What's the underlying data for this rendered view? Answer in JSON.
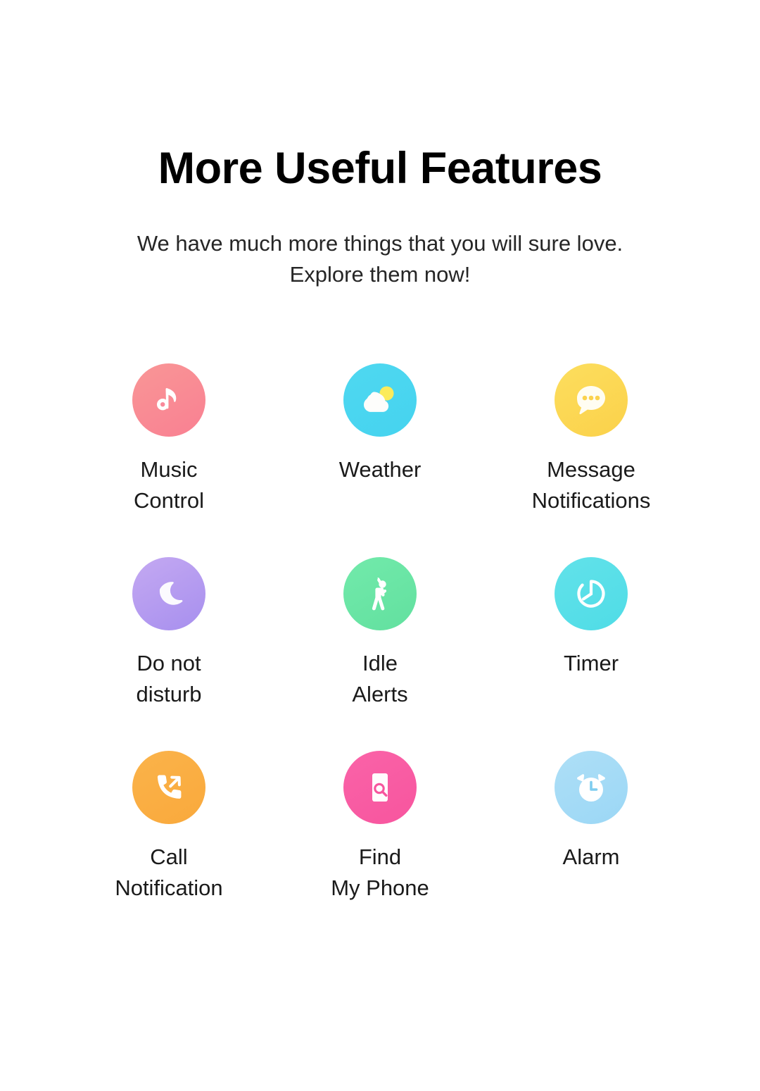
{
  "header": {
    "title": "More Useful Features",
    "subtitle": "We have much more things that you will sure love. Explore them now!"
  },
  "features": [
    {
      "id": "music-control",
      "label": "Music\nControl",
      "icon": "music-note-icon",
      "color_start": "#F99696",
      "color_end": "#F98092"
    },
    {
      "id": "weather",
      "label": "Weather",
      "icon": "cloud-sun-icon",
      "color_start": "#4FD8F0",
      "color_end": "#45D3EF"
    },
    {
      "id": "message-notifications",
      "label": "Message\nNotifications",
      "icon": "speech-bubble-icon",
      "color_start": "#FCDE5E",
      "color_end": "#FBD14A"
    },
    {
      "id": "do-not-disturb",
      "label": "Do not\ndisturb",
      "icon": "crescent-moon-icon",
      "color_start": "#C4A9F2",
      "color_end": "#A78FEE"
    },
    {
      "id": "idle-alerts",
      "label": "Idle\nAlerts",
      "icon": "stretching-person-icon",
      "color_start": "#72EAAB",
      "color_end": "#62E09F"
    },
    {
      "id": "timer",
      "label": "Timer",
      "icon": "stopwatch-icon",
      "color_start": "#62E2EA",
      "color_end": "#4FDCE6"
    },
    {
      "id": "call-notification",
      "label": "Call\nNotification",
      "icon": "incoming-call-icon",
      "color_start": "#FBB34A",
      "color_end": "#F9A93C"
    },
    {
      "id": "find-my-phone",
      "label": "Find\nMy Phone",
      "icon": "phone-search-icon",
      "color_start": "#FA63A8",
      "color_end": "#F7559E"
    },
    {
      "id": "alarm",
      "label": "Alarm",
      "icon": "alarm-clock-icon",
      "color_start": "#AEDFF7",
      "color_end": "#9BD7F5"
    }
  ]
}
